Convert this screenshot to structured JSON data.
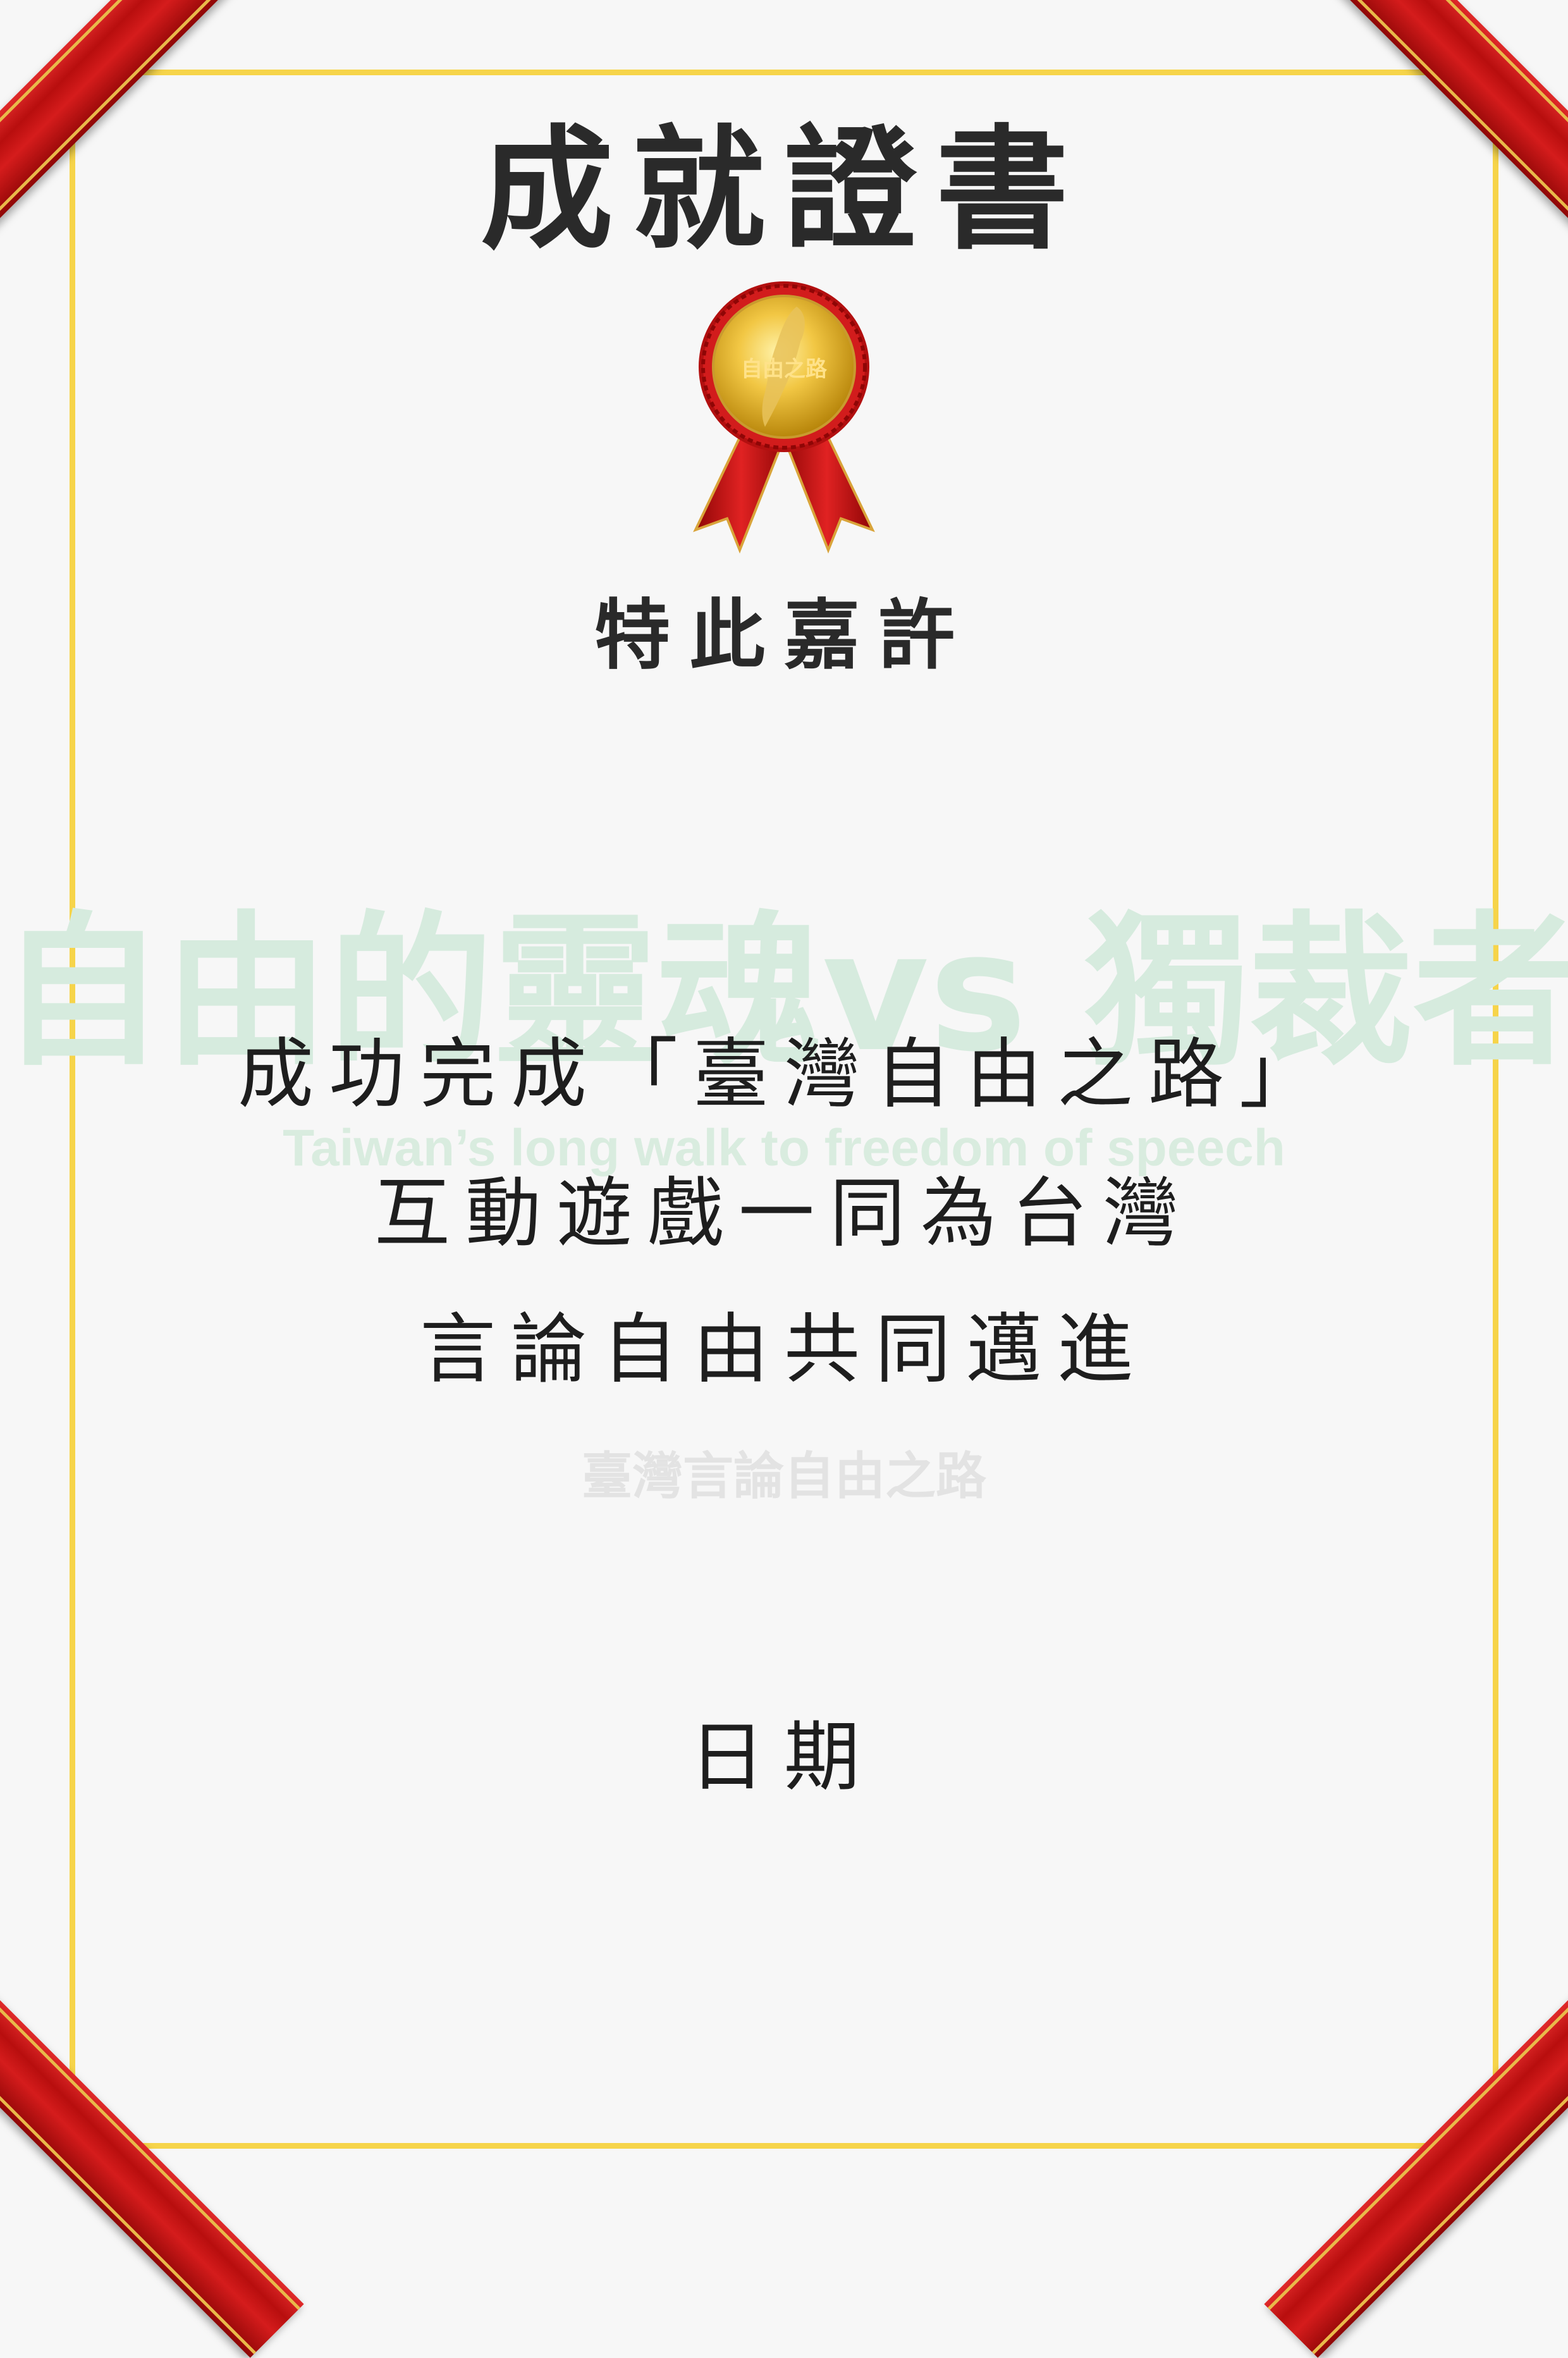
{
  "certificate": {
    "title": "成就證書",
    "subtitle": "特此嘉許",
    "line1": "成功完成「臺灣自由之路」",
    "line2": "互動遊戲一同為台灣",
    "line3": "言論自由共同邁進",
    "date_label": "日期"
  },
  "medal": {
    "label": "自由之路",
    "icon": "taiwan-map-icon"
  },
  "watermark": {
    "main": "自由的靈魂vs 獨裁者",
    "english": "Taiwan’s long walk to freedom of speech",
    "small": "臺灣言論自由之路"
  },
  "colors": {
    "background": "#f7f7f7",
    "frame_gold": "#f6d44a",
    "ribbon_red": "#c41414",
    "watermark_green": "#d6ebde",
    "text": "#1e1e1e"
  }
}
